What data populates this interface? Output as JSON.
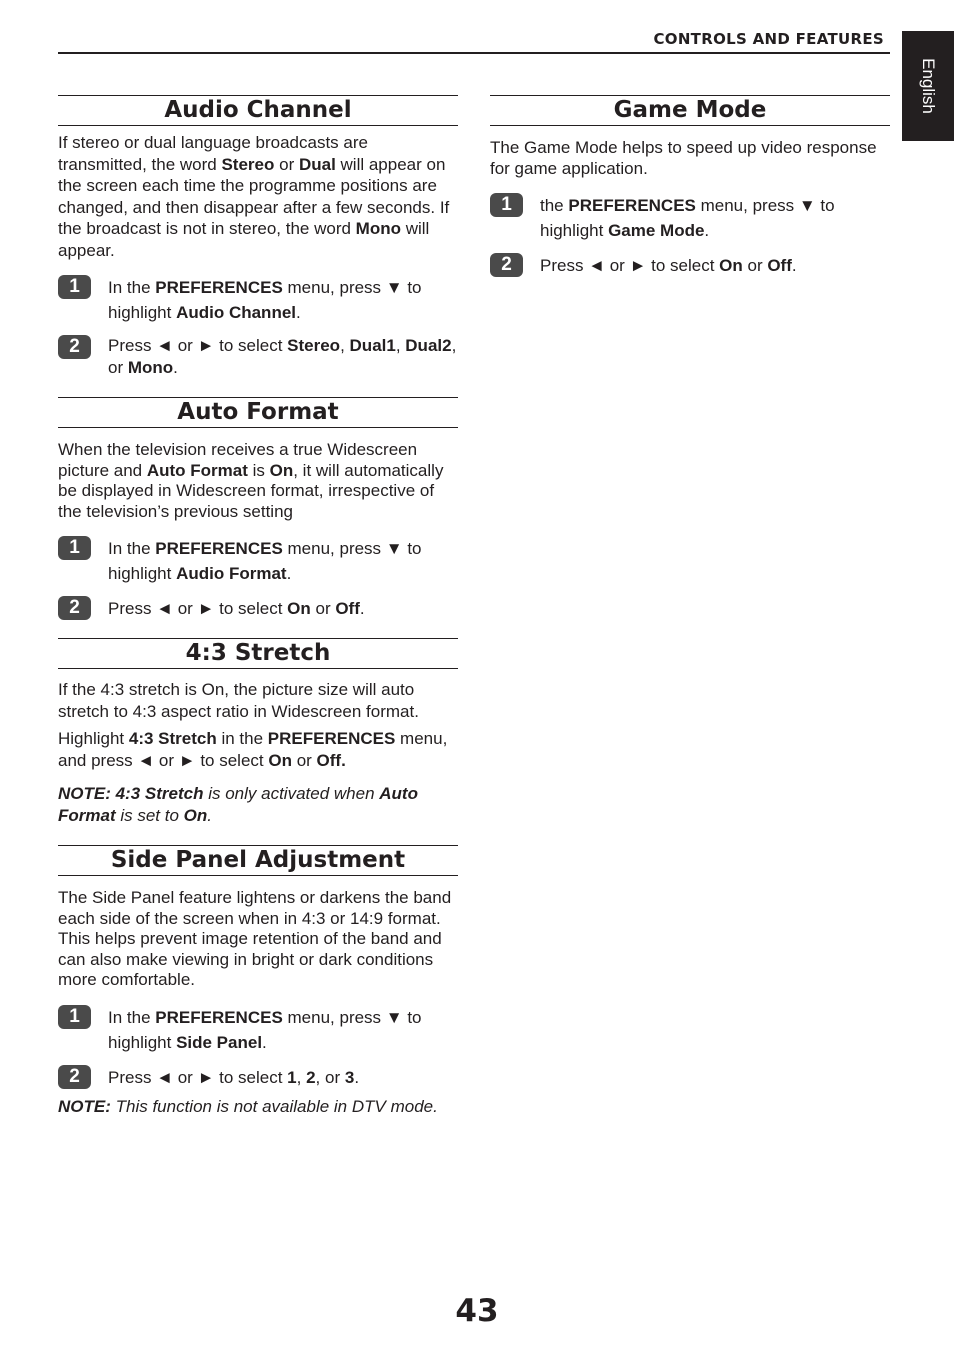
{
  "header": {
    "title": "CONTROLS AND FEATURES",
    "language_tab": "English"
  },
  "page_number": "43",
  "sections": {
    "audio_channel": {
      "title": "Audio Channel",
      "body": [
        "If stereo or dual language broadcasts are transmitted, the word ",
        "Stereo",
        " or ",
        "Dual",
        " will appear on the screen each time the programme positions are changed, and then disappear after a few seconds. If the broadcast is not in stereo, the word ",
        "Mono",
        " will appear."
      ],
      "steps": [
        {
          "num": "1",
          "parts": [
            "In the ",
            "PREFERENCES",
            " menu, press ▼ to highlight ",
            "Audio Channel",
            "."
          ]
        },
        {
          "num": "2",
          "parts": [
            "Press ◄ or ► to select ",
            "Stereo",
            ", ",
            "Dual1",
            ", ",
            "Dual2",
            ", or ",
            "Mono",
            "."
          ]
        }
      ]
    },
    "auto_format": {
      "title": "Auto Format",
      "body": [
        "When the television receives a true Widescreen picture and ",
        "Auto Format",
        " is ",
        "On",
        ", it will automatically be displayed in Widescreen format, irrespective of the television’s previous setting"
      ],
      "steps": [
        {
          "num": "1",
          "parts": [
            "In the ",
            "PREFERENCES",
            " menu, press ▼ to highlight ",
            "Audio Format",
            "."
          ]
        },
        {
          "num": "2",
          "parts": [
            "Press ◄ or ► to select ",
            "On",
            " or ",
            "Off",
            "."
          ]
        }
      ]
    },
    "stretch": {
      "title": "4:3 Stretch",
      "body": "If the 4:3 stretch is On, the picture size will auto stretch to 4:3 aspect ratio in Widescreen format.",
      "body2": [
        "Highlight ",
        "4:3 Stretch",
        " in the ",
        "PREFERENCES",
        " menu, and press ◄ or ► to select ",
        "On",
        " or ",
        "Off."
      ],
      "note": [
        "NOTE: 4:3 Stretch",
        " is only activated when ",
        "Auto Format",
        " is set to ",
        "On",
        "."
      ]
    },
    "side_panel": {
      "title": "Side Panel Adjustment",
      "body": "The Side Panel feature lightens or darkens the band each side of the screen when in 4:3 or 14:9 format. This helps prevent image retention of the band and can also make viewing in bright or dark conditions more comfortable.",
      "steps": [
        {
          "num": "1",
          "parts": [
            "In the ",
            "PREFERENCES",
            " menu, press ▼ to highlight ",
            "Side Panel",
            "."
          ]
        },
        {
          "num": "2",
          "parts": [
            "Press ◄ or ► to select ",
            "1",
            ", ",
            "2",
            ", or ",
            "3",
            "."
          ]
        }
      ],
      "note": [
        "NOTE:",
        " This function is not available in DTV mode."
      ]
    },
    "game_mode": {
      "title": "Game Mode",
      "body": "The Game Mode helps to speed up video response for game application.",
      "steps": [
        {
          "num": "1",
          "parts": [
            "the ",
            "PREFERENCES",
            " menu, press ▼ to highlight ",
            "Game Mode",
            "."
          ]
        },
        {
          "num": "2",
          "parts": [
            "Press ◄ or ► to select ",
            "On",
            " or ",
            "Off",
            "."
          ]
        }
      ]
    }
  }
}
